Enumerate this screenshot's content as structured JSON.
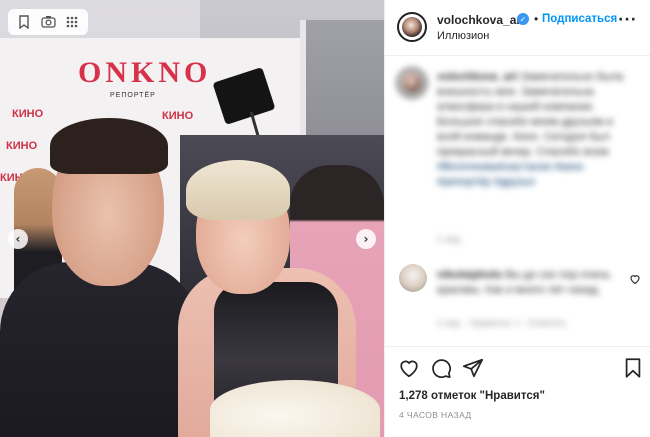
{
  "post": {
    "username": "volochkova_art",
    "verified_mark": "✓",
    "separator": "•",
    "follow_label": "Подписаться",
    "location": "Иллюзион",
    "more_label": "···"
  },
  "photo": {
    "brand_logo": "ONKNO",
    "brand_logo_sub": "РЕПОРТЁР",
    "press_wall_logo": "КИНО",
    "prev_arrow": "‹",
    "next_arrow": "›",
    "toolbar_icons": [
      "bookmark-icon",
      "visual-search-icon",
      "grid-icon"
    ]
  },
  "caption": {
    "author": "volochkova_art",
    "text": "Замечательно была внешность моя. Замечательна атмосфера в нашей компании. Большое спасибо моим друзьям и всей команде. Кино. Сегодня был прекрасный вечер. Спасибо всем",
    "tags": "#ВолочковаАнастасия #кино #репортёр #друзья",
    "age": "1 нед."
  },
  "comment": {
    "author": "nikolaiphoto",
    "text": "Вы до сих пор очень красивы. Как и много лет назад",
    "meta": "1 нед. · Нравится: 1 · Ответить"
  },
  "actions": {
    "icons": [
      "heart-icon",
      "comment-icon",
      "share-icon",
      "save-icon"
    ],
    "likes_label": "1,278 отметок \"Нравится\"",
    "time_label": "4 ЧАСОВ НАЗАД"
  },
  "colors": {
    "accent_blue": "#0095f6",
    "text": "#262626",
    "muted": "#8e8e8e"
  }
}
